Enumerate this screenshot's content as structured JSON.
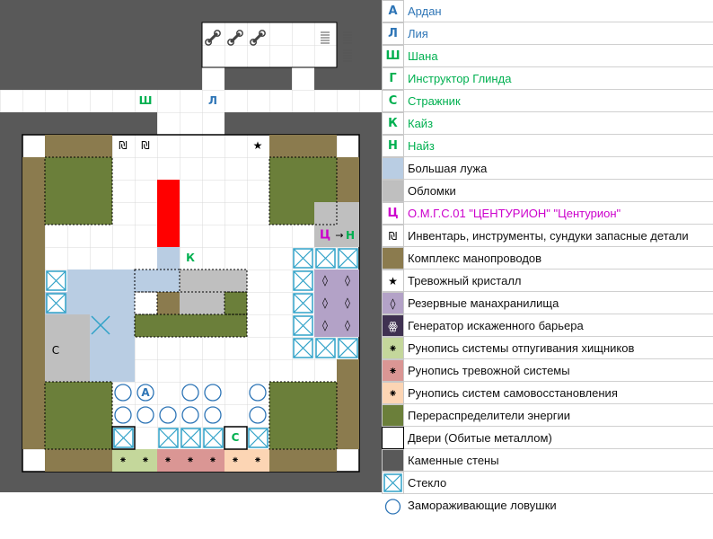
{
  "colors": {
    "wall": "#595959",
    "pipes": "#8b7b4e",
    "redistributor": "#6b7f3a",
    "puddle": "#b9cde3",
    "debris": "#bfbfbf",
    "red": "#ff0000",
    "mana": "#b3a2c7",
    "glass": "#31a2c8",
    "rune_green": "#c4d79b",
    "rune_red": "#da9694",
    "rune_orange": "#fcd5b4",
    "blue_letter": "#2e75b6",
    "green_letter": "#00b050",
    "magenta": "#cc00cc"
  },
  "map": {
    "characters": {
      "ardan": "А",
      "liya": "Л",
      "shana": "Ш",
      "guard": "С",
      "kaiz": "К",
      "naiz": "Н",
      "centurion": "Ц",
      "arrow": "→"
    },
    "icons": {
      "tool": "wrench-icon",
      "chest": "chest-icon",
      "inventory": "₪",
      "crystal": "★",
      "mana": "◊",
      "rune": "⁕"
    }
  },
  "legend": {
    "items": [
      {
        "symbol": "А",
        "label": "Ардан",
        "symbol_color": "#2e75b6",
        "label_color": "#2e75b6"
      },
      {
        "symbol": "Л",
        "label": "Лия",
        "symbol_color": "#2e75b6",
        "label_color": "#2e75b6"
      },
      {
        "symbol": "Ш",
        "label": "Шана",
        "symbol_color": "#00b050",
        "label_color": "#00b050"
      },
      {
        "symbol": "Г",
        "label": "Инструктор Глинда",
        "symbol_color": "#00b050",
        "label_color": "#00b050"
      },
      {
        "symbol": "С",
        "label": "Стражник",
        "symbol_color": "#00b050",
        "label_color": "#00b050"
      },
      {
        "symbol": "К",
        "label": "Кайз",
        "symbol_color": "#00b050",
        "label_color": "#00b050"
      },
      {
        "symbol": "Н",
        "label": "Найз",
        "symbol_color": "#00b050",
        "label_color": "#00b050"
      },
      {
        "symbol": "",
        "label": "Большая лужа",
        "fill": "#b9cde3"
      },
      {
        "symbol": "",
        "label": "Обломки",
        "fill": "#bfbfbf"
      },
      {
        "symbol": "Ц",
        "label": "О.М.Г.С.01 \"ЦЕНТУРИОН\" \"Центурион\"",
        "symbol_color": "#cc00cc",
        "label_color": "#cc00cc"
      },
      {
        "symbol": "₪",
        "label": "Инвентарь, инструменты, сундуки запасные детали",
        "symbol_color": "#000000"
      },
      {
        "symbol": "",
        "label": "Комплекс манопроводов",
        "fill": "#8b7b4e"
      },
      {
        "symbol": "★",
        "label": "Тревожный кристалл",
        "symbol_color": "#000000"
      },
      {
        "symbol": "◊",
        "label": "Резервные манахранилища",
        "fill": "#b3a2c7",
        "symbol_color": "#000000"
      },
      {
        "symbol": "ꙮ",
        "label": "Генератор искаженного барьера",
        "fill": "#3f3151",
        "symbol_color": "#ffffff"
      },
      {
        "symbol": "⁕",
        "label": "Рунопись системы отпугивания хищников",
        "fill": "#c4d79b",
        "symbol_color": "#000000"
      },
      {
        "symbol": "⁕",
        "label": "Рунопись тревожной системы",
        "fill": "#da9694",
        "symbol_color": "#000000"
      },
      {
        "symbol": "⁕",
        "label": "Рунопись систем самовосстановления",
        "fill": "#fcd5b4",
        "symbol_color": "#000000"
      },
      {
        "symbol": "",
        "label": "Перераспределители энергии",
        "fill": "#6b7f3a"
      },
      {
        "symbol": "",
        "label": "Двери (Обитые металлом)",
        "fill": "#ffffff",
        "door": true
      },
      {
        "symbol": "",
        "label": "Каменные стены",
        "fill": "#595959"
      },
      {
        "symbol": "",
        "label": "Стекло",
        "glass": true
      }
    ],
    "freeze_label": "Замораживающие ловушки"
  }
}
